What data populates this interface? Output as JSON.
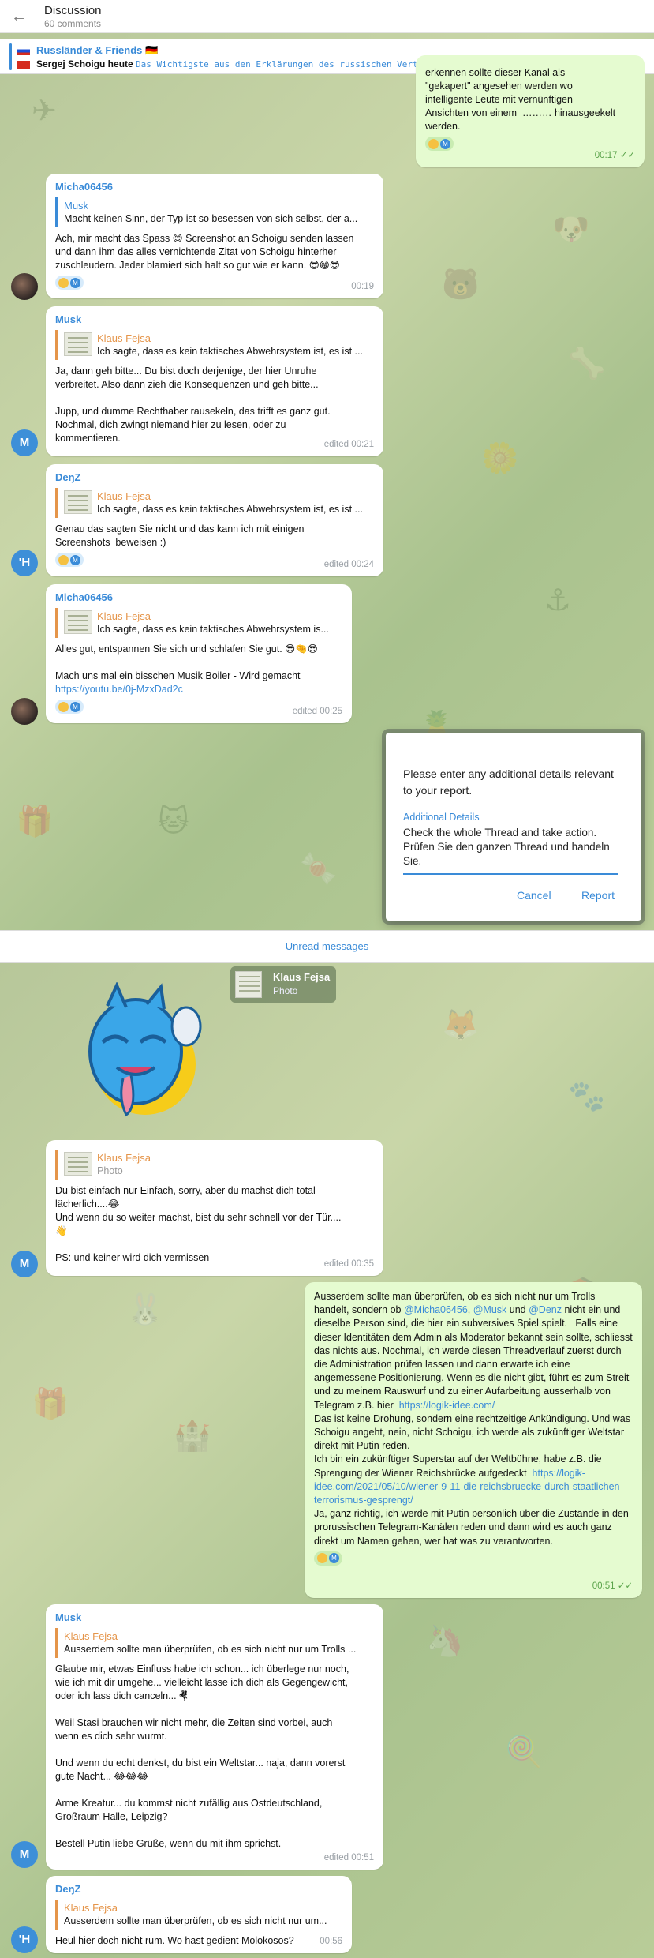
{
  "header": {
    "title": "Discussion",
    "subtitle": "60 comments",
    "back_icon": "back-arrow-icon"
  },
  "pinned": {
    "channel": "Russländer & Friends 🇩🇪",
    "name": "Sergej Schoigu heute",
    "snippet": "Das Wichtigste aus den Erklärungen des russischen Verteidigungsministers Sergej Schoigu: …"
  },
  "messages": {
    "m0": {
      "text": "erkennen sollte dieser Kanal als\n\"gekapert\" angesehen werden wo\nintelligente Leute mit vernünftigen\nAnsichten von einem  ……… hinausgeekelt\nwerden.",
      "time": "00:17"
    },
    "m1": {
      "author": "Micha06456",
      "reply_name": "Musk",
      "reply_text": "Macht keinen Sinn, der Typ ist so besessen von sich selbst, der a...",
      "text": "Ach, mir macht das Spass 😊 Screenshot an Schoigu senden lassen\nund dann ihm das alles vernichtende Zitat von Schoigu hinterher\nzuschleudern. Jeder blamiert sich halt so gut wie er kann. 😎😁😎",
      "time": "00:19"
    },
    "m2": {
      "author": "Musk",
      "reply_name": "Klaus Fejsa",
      "reply_text": "Ich sagte, dass es kein taktisches Abwehrsystem ist, es ist ...",
      "text": "Ja, dann geh bitte... Du bist doch derjenige, der hier Unruhe\nverbreitet. Also dann zieh die Konsequenzen und geh bitte...\n\nJupp, und dumme Rechthaber rausekeln, das trifft es ganz gut.\nNochmal, dich zwingt niemand hier zu lesen, oder zu\nkommentieren.",
      "time": "edited 00:21",
      "avatar": "M"
    },
    "m3": {
      "author": "DeŋZ",
      "reply_name": "Klaus Fejsa",
      "reply_text": "Ich sagte, dass es kein taktisches Abwehrsystem ist, es ist ...",
      "text": "Genau das sagten Sie nicht und das kann ich mit einigen\nScreenshots  beweisen :)",
      "time": "edited 00:24",
      "avatar": "'H"
    },
    "m4": {
      "author": "Micha06456",
      "reply_name": "Klaus Fejsa",
      "reply_text": "Ich sagte, dass es kein taktisches Abwehrsystem is...",
      "text": "Alles gut, entspannen Sie sich und schlafen Sie gut. 😎🤏😎\n\nMach uns mal ein bisschen Musik Boiler - Wird gemacht",
      "link": "https://youtu.be/0j-MzxDad2c",
      "time": "edited 00:25"
    },
    "forward": {
      "name": "Klaus Fejsa",
      "type": "Photo"
    },
    "m5": {
      "reply_name": "Klaus Fejsa",
      "reply_text": "Photo",
      "text": "Du bist einfach nur Einfach, sorry, aber du machst dich total\nlächerlich....😂\nUnd wenn du so weiter machst, bist du sehr schnell vor der Tür....\n👋\n\nPS: und keiner wird dich vermissen",
      "time": "edited 00:35",
      "avatar": "M"
    },
    "m6": {
      "p1": "Ausserdem sollte man überprüfen, ob es sich nicht nur um Trolls handelt, sondern ob ",
      "mention1": "@Micha06456",
      "comma": ", ",
      "mention2": "@Musk",
      "und": " und ",
      "mention3": "@Denz",
      "p2": " nicht ein und dieselbe Person sind, die hier ein subversives Spiel spielt.   Falls eine dieser Identitäten dem Admin als Moderator bekannt sein sollte, schliesst das nichts aus. Nochmal, ich werde diesen Threadverlauf zuerst durch die Administration prüfen lassen und dann erwarte ich eine angemessene Positionierung. Wenn es die nicht gibt, führt es zum Streit und zu meinem Rauswurf und zu einer Aufarbeitung ausserhalb von Telegram z.B. hier  ",
      "link1": "https://logik-idee.com/",
      "p3": "\nDas ist keine Drohung, sondern eine rechtzeitige Ankündigung. Und was Schoigu angeht, nein, nicht Schoigu, ich werde als zukünftiger Weltstar direkt mit Putin reden.\nIch bin ein zukünftiger Superstar auf der Weltbühne, habe z.B. die Sprengung der Wiener Reichsbrücke aufgedeckt  ",
      "link2": "https://logik-idee.com/2021/05/10/wiener-9-11-die-reichsbruecke-durch-staatlichen-terrorismus-gesprengt/",
      "p4": "\nJa, ganz richtig, ich werde mit Putin persönlich über die Zustände in den prorussischen Telegram-Kanälen reden und dann wird es auch ganz direkt um Namen gehen, wer hat was zu verantworten.",
      "time": "00:51"
    },
    "m7": {
      "author": "Musk",
      "reply_name": "Klaus Fejsa",
      "reply_text": "Ausserdem sollte man überprüfen, ob es sich nicht nur um Trolls ...",
      "text": "Glaube mir, etwas Einfluss habe ich schon... ich überlege nur noch,\nwie ich mit dir umgehe... vielleicht lasse ich dich als Gegengewicht,\noder ich lass dich canceln... 🤻\n\nWeil Stasi brauchen wir nicht mehr, die Zeiten sind vorbei, auch\nwenn es dich sehr wurmt.\n\nUnd wenn du echt denkst, du bist ein Weltstar... naja, dann vorerst\ngute Nacht... 😂😂😂\n\nArme Kreatur... du kommst nicht zufällig aus Ostdeutschland,\nGroßraum Halle, Leipzig?\n\nBestell Putin liebe Grüße, wenn du mit ihm sprichst.",
      "time": "edited 00:51",
      "avatar": "M"
    },
    "m8": {
      "author": "DeŋZ",
      "reply_name": "Klaus Fejsa",
      "reply_text": "Ausserdem sollte man überprüfen, ob es sich nicht nur um...",
      "text": "Heul hier doch nicht rum. Wo hast gedient Molokosos?",
      "time": "00:56",
      "avatar": "'H"
    }
  },
  "unread": "Unread messages",
  "dialog": {
    "question": "Please enter any additional details relevant to your report.",
    "label": "Additional Details",
    "value": "Check the whole Thread and take action.  Prüfen Sie den ganzen Thread und handeln Sie.",
    "cancel": "Cancel",
    "report": "Report"
  },
  "colors": {
    "accent": "#3a8bd8",
    "reply_accent": "#e5954a",
    "outgoing_bubble": "#e5fbd0"
  }
}
